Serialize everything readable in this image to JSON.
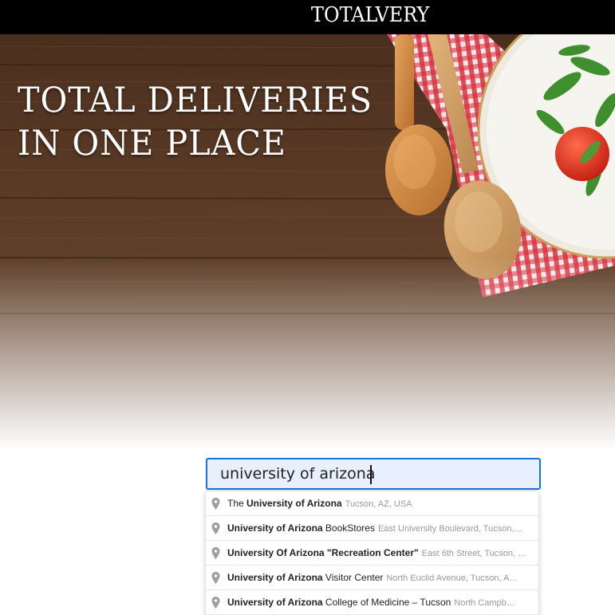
{
  "header": {
    "brand": "TOTALVERY"
  },
  "hero": {
    "title_line1": "TOTAL DELIVERIES",
    "title_line2": "IN ONE PLACE"
  },
  "search": {
    "value": "university of arizona",
    "placeholder": ""
  },
  "suggestions": [
    {
      "prefix": "The ",
      "match": "University of Arizona",
      "rest": "",
      "secondary": "Tucson, AZ, USA"
    },
    {
      "prefix": "",
      "match": "University of Arizona",
      "rest": " BookStores",
      "secondary": "East University Boulevard, Tucson,…"
    },
    {
      "prefix": "",
      "match": "University Of Arizona",
      "rest": " \"Recreation Center\"",
      "secondary": "East 6th Street, Tucson, …"
    },
    {
      "prefix": "",
      "match": "University of Arizona",
      "rest": " Visitor Center",
      "secondary": "North Euclid Avenue, Tucson, A…"
    },
    {
      "prefix": "",
      "match": "University of Arizona",
      "rest": " College of Medicine – Tucson",
      "secondary": "North Campb…"
    }
  ],
  "colors": {
    "topbar": "#000000",
    "search_border": "#1a73d9",
    "search_fill": "#e8f0fd",
    "wood": "#5a3b26"
  },
  "icons": {
    "suggestion_icon": "map-pin-icon"
  }
}
